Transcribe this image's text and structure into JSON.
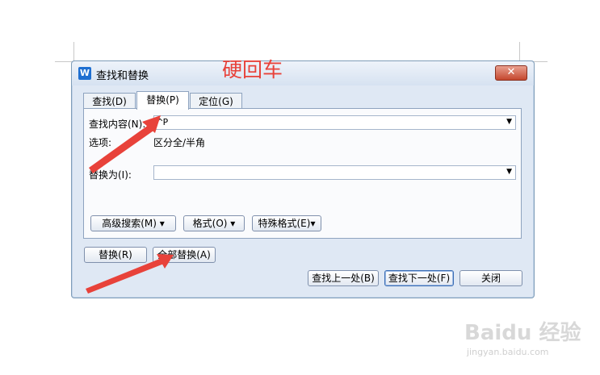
{
  "annotation": {
    "text": "硬回车"
  },
  "dialog": {
    "title": "查找和替换",
    "app_icon": "W",
    "close_glyph": "✕",
    "tabs": [
      {
        "label": "查找(D)"
      },
      {
        "label": "替换(P)"
      },
      {
        "label": "定位(G)"
      }
    ],
    "find": {
      "label": "查找内容(N):",
      "value": "^P"
    },
    "options": {
      "label": "选项:",
      "value": "区分全/半角"
    },
    "replace": {
      "label": "替换为(I):",
      "value": ""
    },
    "panel_buttons": {
      "advanced": "高级搜索(M) ▾",
      "format": "格式(O) ▾",
      "special": "特殊格式(E)▾"
    },
    "buttons": {
      "replace": "替换(R)",
      "replace_all": "全部替换(A)",
      "find_prev": "查找上一处(B)",
      "find_next": "查找下一处(F)",
      "close": "关闭"
    }
  },
  "watermark": {
    "text": "Baidu 经验",
    "url": "jingyan.baidu.com"
  }
}
